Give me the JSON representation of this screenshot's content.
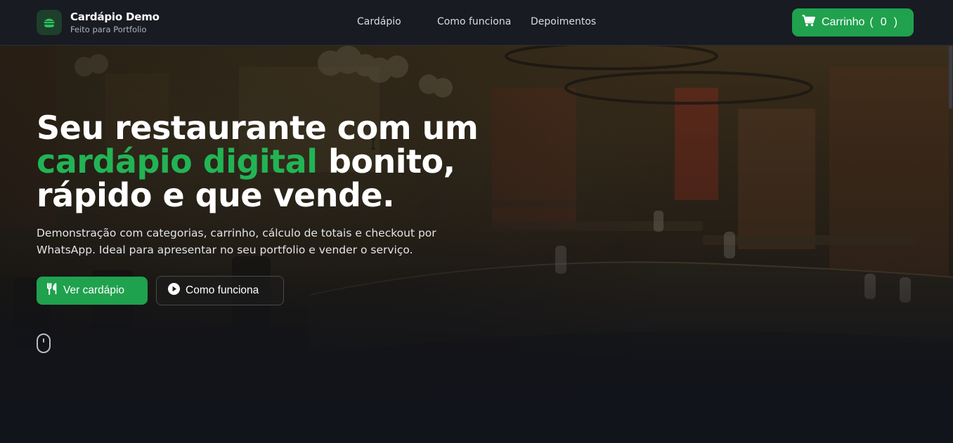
{
  "header": {
    "brand_title": "Cardápio Demo",
    "brand_subtitle": "Feito para Portfolio",
    "brand_icon": "burger-icon",
    "nav": [
      {
        "label": "Cardápio"
      },
      {
        "label": "Como funciona"
      },
      {
        "label": "Depoimentos"
      }
    ],
    "cart": {
      "label": "Carrinho",
      "open_paren": "(",
      "count": "0",
      "close_paren": ")",
      "icon": "cart-icon"
    }
  },
  "hero": {
    "headline_part1": "Seu restaurante com um",
    "headline_accent": "cardápio digital",
    "headline_part2": " bonito,",
    "headline_part3": "rápido e que vende.",
    "lead": "Demonstração com categorias, carrinho, cálculo de totais e checkout por WhatsApp. Ideal para apresentar no seu portfolio e vender o serviço.",
    "primary_cta": {
      "label": "Ver cardápio",
      "icon": "utensils-icon"
    },
    "secondary_cta": {
      "label": "Como funciona",
      "icon": "play-circle-icon"
    },
    "scroll_hint_icon": "mouse-icon"
  },
  "colors": {
    "accent": "#1fa14d",
    "accent_text": "#22b454",
    "header_bg": "#181b22",
    "page_bg": "#12141b"
  }
}
